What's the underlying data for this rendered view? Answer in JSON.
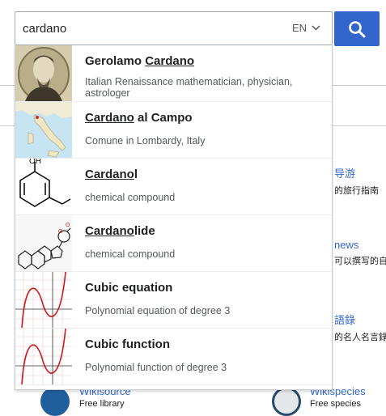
{
  "search": {
    "value": "cardano",
    "language": "EN",
    "button_label": "Search"
  },
  "suggestions": [
    {
      "prefix": "Gerolamo ",
      "match": "Cardano",
      "suffix": "",
      "description": "Italian Renaissance mathematician, physician, astrologer",
      "thumb": "portrait"
    },
    {
      "prefix": "",
      "match": "Cardano",
      "suffix": " al Campo",
      "description": "Comune in Lombardy, Italy",
      "thumb": "map"
    },
    {
      "prefix": "",
      "match": "Cardano",
      "suffix": "l",
      "description": "chemical compound",
      "thumb": "phenol-structure"
    },
    {
      "prefix": "",
      "match": "Cardano",
      "suffix": "lide",
      "description": "chemical compound",
      "thumb": "steroid-structure"
    },
    {
      "prefix": "Cubic equation",
      "match": "",
      "suffix": "",
      "description": "Polynomial equation of degree 3",
      "thumb": "cubic-graph"
    },
    {
      "prefix": "Cubic function",
      "match": "",
      "suffix": "",
      "description": "Polynomial function of degree 3",
      "thumb": "cubic-graph"
    }
  ],
  "background": {
    "items": [
      {
        "title": "导游",
        "subtitle": "的旅行指南"
      },
      {
        "title": "news",
        "subtitle": "可以撰写的自"
      },
      {
        "title": "語錄",
        "subtitle": "的名人名言錄"
      }
    ],
    "bottom_left": {
      "title": "Wikisource",
      "subtitle": "Free library"
    },
    "bottom_right": {
      "title": "Wikispecies",
      "subtitle": "Free species"
    }
  },
  "colors": {
    "accent": "#3366cc",
    "text": "#202122",
    "muted": "#54595d",
    "border": "#a2a9b1"
  }
}
